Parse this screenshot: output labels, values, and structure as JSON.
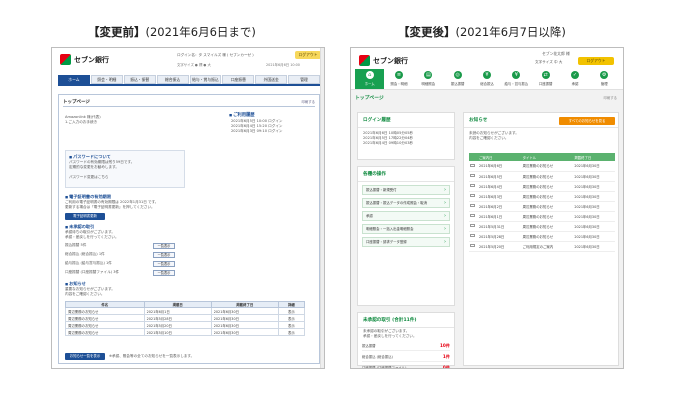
{
  "captions": {
    "before_bold": "【変更前】",
    "before_rest": "(2021年6月6日まで)",
    "after_bold": "【変更後】",
    "after_rest": "(2021年6月7日以降)"
  },
  "brand": {
    "name": "セブン銀行",
    "red": "#e60012",
    "green": "#009944"
  },
  "before": {
    "user_line": "ログイン名：タ スマイルズ 様 ( セブンカーゼ )",
    "logout": "ログアウト",
    "sub_line": "文字サイズ ● 標 ● 大",
    "date_line": "2021年6月6日 10:00",
    "nav": [
      "ホーム",
      "照会・明細",
      "振込・振替",
      "総合振込",
      "給与・賞与振込",
      "口座振替",
      "外国送金",
      "管理"
    ],
    "panel_title": "トップページ",
    "print": "印刷する",
    "welcome": [
      "Amazonlink 様(代表)",
      "1.ご入力のお手続き"
    ],
    "history_title": "ご利用履歴",
    "history": [
      "2021年6月5日 10:00 ログイン",
      "2021年6月4日 15:20 ログイン",
      "2021年6月3日 09:10 ログイン"
    ],
    "pw_title": "パスワードについて",
    "pw_lines": [
      "パスワードの有効期限は残り59日です。",
      "定期的な変更をお勧めします。",
      "",
      "パスワード変更はこちら"
    ],
    "cert_title": "電子証明書の有効期限",
    "cert_lines": [
      "ご利用の電子証明書の有効期限は 2022年1月31日 です。",
      "更新する場合は「電子証明書更新」を押してください。"
    ],
    "cert_button": "電子証明書更新",
    "pending_title": "未承認の取引",
    "pending_desc": [
      "承認待ちの取引がございます。",
      "承認・差戻しを行ってください。"
    ],
    "pending_rows": [
      {
        "label": "振込振替 5件",
        "btn": "一覧表示"
      },
      {
        "label": "総合振込 (総合振込) 1件",
        "btn": "一覧表示"
      },
      {
        "label": "給与振込 (給与賞与振込) 1件",
        "btn": "一覧表示"
      },
      {
        "label": "口座振替 (口座振替ファイル) 3件",
        "btn": "一覧表示"
      }
    ],
    "notice_title": "お知らせ",
    "notice_desc": [
      "重要なお知らせがございます。",
      "内容をご確認ください。"
    ],
    "table_head": [
      "件名",
      "掲載日",
      "掲載終了日",
      "詳細"
    ],
    "table_rows": [
      [
        "周辺業務のお知らせ",
        "2021年6月1日",
        "2021年6月30日",
        "表示"
      ],
      [
        "周辺業務のお知らせ",
        "2021年5月28日",
        "2021年6月30日",
        "表示"
      ],
      [
        "周辺業務のお知らせ",
        "2021年5月20日",
        "2021年6月30日",
        "表示"
      ],
      [
        "周辺業務のお知らせ",
        "2021年5月10日",
        "2021年6月30日",
        "表示"
      ]
    ],
    "bottom_button": "お知らせ一覧を表示",
    "bottom_note": "※承認、照会等の全てのお知らせを一覧表示します。"
  },
  "after": {
    "name_line": "セブン花太郎 様",
    "size_line": "文字サイズ 中 大",
    "logout": "ログアウト",
    "nav": [
      "ホーム",
      "照会・明細",
      "明細照会",
      "振込振替",
      "総合振込",
      "給与・賞与振込",
      "口座振替",
      "承認",
      "管理"
    ],
    "nav_icons": [
      "⌂",
      "≡",
      "▤",
      "◎",
      "¥",
      "¥",
      "⇄",
      "✓",
      "⚙"
    ],
    "page_title": "トップページ",
    "print": "印刷する",
    "login_title": "ログイン履歴",
    "login_rows": [
      "2021年6月6日 10時05分05秒",
      "2021年6月5日 17時22分04秒",
      "2021年6月4日 09時10分03秒"
    ],
    "ops_title": "各種の操作",
    "ops": [
      "振込振替・新規受付",
      "振込振替・振込データの作成照会・取消",
      "承認",
      "明細照会・一括入出金明細照会",
      "口座振替・請求データ登録"
    ],
    "pend_title": "未承認の取引 (合計11件)",
    "pend_desc": [
      "未承認の取引がございます。",
      "承認・差戻しを行ってください。"
    ],
    "pend_rows": [
      {
        "label": "振込振替",
        "count": "10件"
      },
      {
        "label": "総合振込 (総合振込)",
        "count": "1件"
      },
      {
        "label": "口座振替 (口座振替ファイル)",
        "count": "0件"
      }
    ],
    "news_title": "お知らせ",
    "news_all": "すべてのお知らせを見る",
    "news_desc": [
      "未読のお知らせがございます。",
      "内容をご確認ください。"
    ],
    "news_head": [
      "",
      "ご案内日",
      "タイトル",
      "掲載終了日"
    ],
    "news_rows": [
      [
        "2021年6月6日",
        "周辺業務のお知らせ",
        "2021年6月30日"
      ],
      [
        "2021年6月5日",
        "周辺業務のお知らせ",
        "2021年6月30日"
      ],
      [
        "2021年6月4日",
        "周辺業務のお知らせ",
        "2021年6月30日"
      ],
      [
        "2021年6月3日",
        "周辺業務のお知らせ",
        "2021年6月30日"
      ],
      [
        "2021年6月2日",
        "周辺業務のお知らせ",
        "2021年6月30日"
      ],
      [
        "2021年6月1日",
        "周辺業務のお知らせ",
        "2021年6月30日"
      ],
      [
        "2021年5月31日",
        "周辺業務のお知らせ",
        "2021年6月30日"
      ],
      [
        "2021年5月28日",
        "周辺業務のお知らせ",
        "2021年6月30日"
      ],
      [
        "2021年5月20日",
        "ご利用規定のご案内",
        "2021年6月30日"
      ]
    ]
  }
}
